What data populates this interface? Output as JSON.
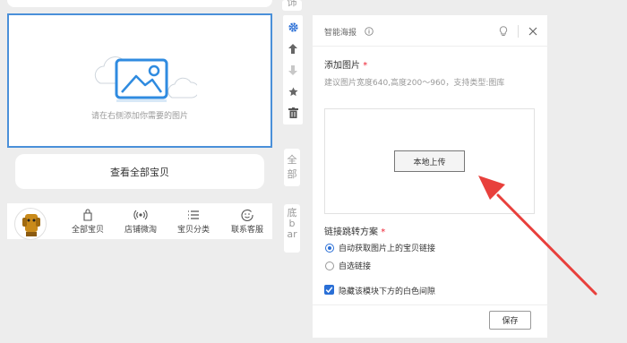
{
  "preview": {
    "placeholder_text": "请在右侧添加你需要的图片",
    "view_all_label": "查看全部宝贝",
    "nav_items": [
      {
        "label": "全部宝贝",
        "icon": "bag-icon"
      },
      {
        "label": "店铺微淘",
        "icon": "broadcast-icon"
      },
      {
        "label": "宝贝分类",
        "icon": "list-icon"
      },
      {
        "label": "联系客服",
        "icon": "smile-icon"
      }
    ]
  },
  "side_tabs": {
    "top": "饰",
    "all": "全部",
    "bar": "底bar"
  },
  "panel": {
    "title": "智能海报",
    "add_image_label": "添加图片",
    "required_mark": "*",
    "hint": "建议图片宽度640,高度200～960，支持类型:图库",
    "upload_button": "本地上传",
    "link_label": "链接跳转方案",
    "radio_auto": "自动获取图片上的宝贝链接",
    "radio_custom": "自选链接",
    "checkbox_label": "隐藏该模块下方的白色间隙",
    "save_button": "保存"
  },
  "colors": {
    "accent": "#2a6fd6",
    "selection_border": "#4a90d9",
    "annotation_arrow": "#e8403c"
  }
}
